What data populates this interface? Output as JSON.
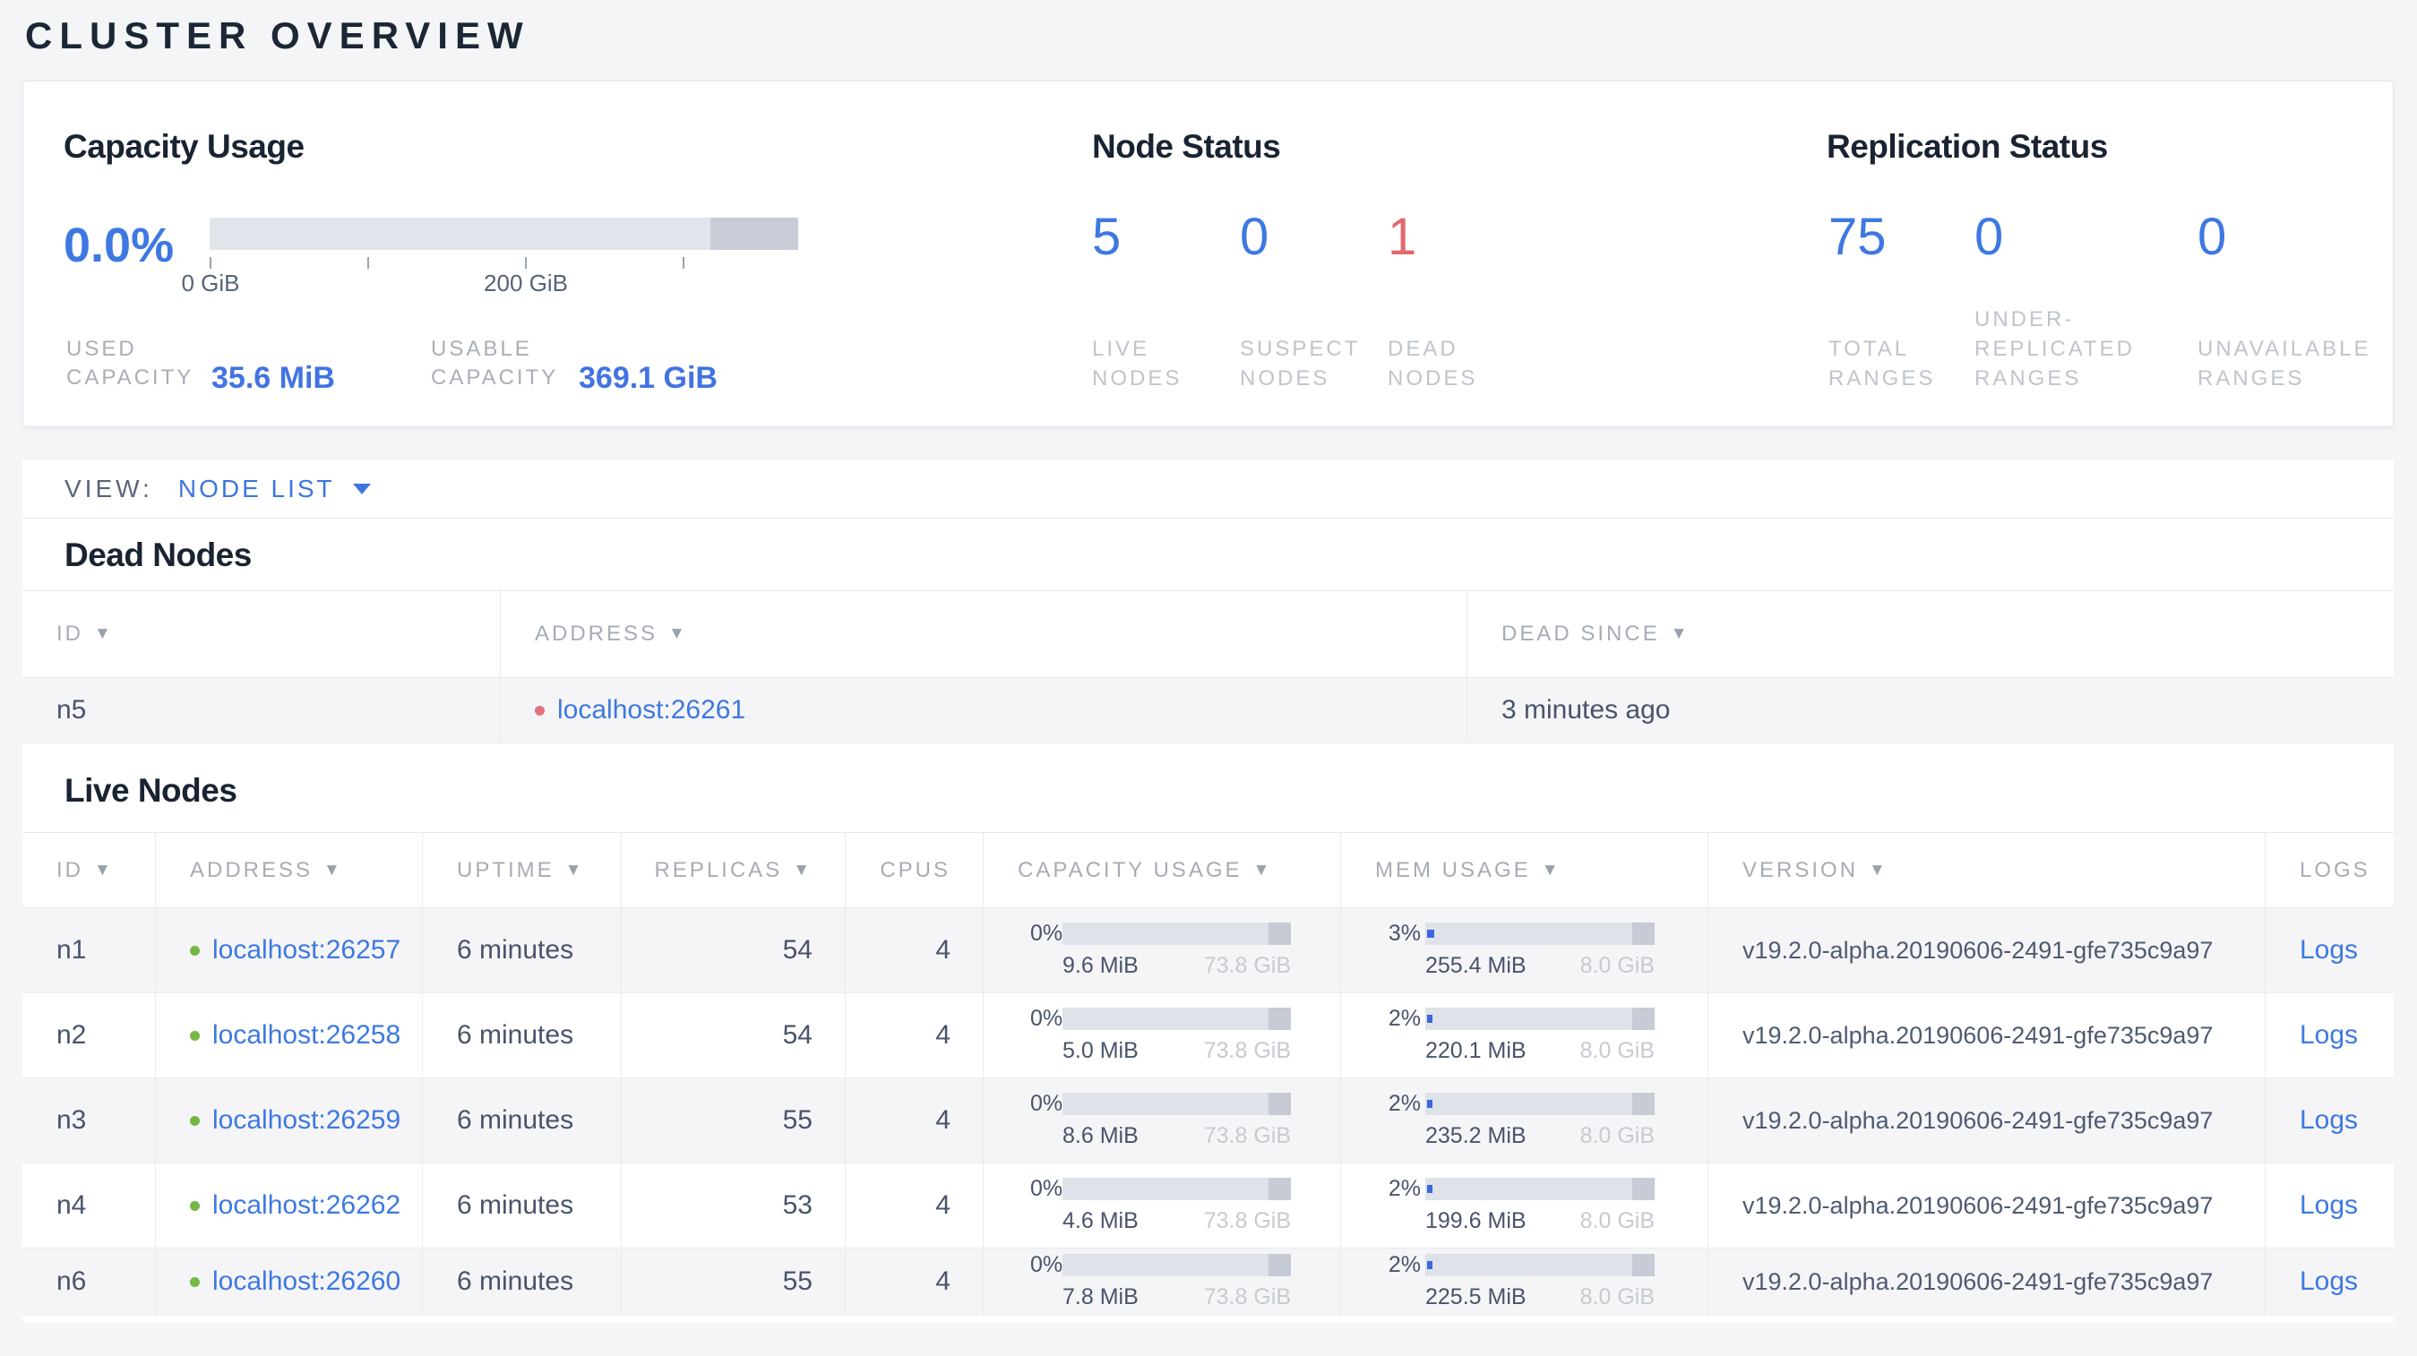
{
  "page_title": "CLUSTER OVERVIEW",
  "colors": {
    "accent_blue": "#3e78e1",
    "danger_red": "#e0696e",
    "live_green": "#76b847",
    "dead_dot": "#e0737c",
    "link_blue": "#3d79e0"
  },
  "summary": {
    "capacity": {
      "title": "Capacity Usage",
      "percent": "0.0%",
      "axis_ticks": [
        {
          "label": "0 GiB"
        },
        {
          "label": ""
        },
        {
          "label": "200 GiB"
        },
        {
          "label": ""
        }
      ],
      "stats": [
        {
          "label": "USED\nCAPACITY",
          "value": "35.6 MiB"
        },
        {
          "label": "USABLE\nCAPACITY",
          "value": "369.1 GiB"
        }
      ]
    },
    "node_status": {
      "title": "Node Status",
      "stats": [
        {
          "value": "5",
          "label": "LIVE\nNODES",
          "color": "blue"
        },
        {
          "value": "0",
          "label": "SUSPECT\nNODES",
          "color": "blue"
        },
        {
          "value": "1",
          "label": "DEAD\nNODES",
          "color": "red"
        }
      ]
    },
    "replication": {
      "title": "Replication Status",
      "stats": [
        {
          "value": "75",
          "label": "TOTAL\nRANGES",
          "color": "blue"
        },
        {
          "value": "0",
          "label": "UNDER-\nREPLICATED\nRANGES",
          "color": "blue"
        },
        {
          "value": "0",
          "label": "UNAVAILABLE\nRANGES",
          "color": "blue"
        }
      ]
    }
  },
  "view_bar": {
    "label": "VIEW:",
    "value": "NODE LIST"
  },
  "dead_nodes": {
    "title": "Dead Nodes",
    "columns": [
      {
        "label": "ID",
        "sortable": true
      },
      {
        "label": "ADDRESS",
        "sortable": true
      },
      {
        "label": "DEAD SINCE",
        "sortable": true
      }
    ],
    "rows": [
      {
        "id": "n5",
        "address": "localhost:26261",
        "dead_since": "3 minutes ago"
      }
    ]
  },
  "live_nodes": {
    "title": "Live Nodes",
    "columns": [
      {
        "label": "ID",
        "sortable": true
      },
      {
        "label": "ADDRESS",
        "sortable": true
      },
      {
        "label": "UPTIME",
        "sortable": true
      },
      {
        "label": "REPLICAS",
        "sortable": true,
        "align": "right"
      },
      {
        "label": "CPUS",
        "sortable": false,
        "align": "right"
      },
      {
        "label": "CAPACITY USAGE",
        "sortable": true
      },
      {
        "label": "MEM USAGE",
        "sortable": true
      },
      {
        "label": "VERSION",
        "sortable": true
      },
      {
        "label": "LOGS",
        "sortable": false
      }
    ],
    "rows": [
      {
        "id": "n1",
        "address": "localhost:26257",
        "uptime": "6 minutes",
        "replicas": "54",
        "cpus": "4",
        "capacity": {
          "percent": "0%",
          "pct_num": 0,
          "used": "9.6 MiB",
          "total": "73.8 GiB"
        },
        "memory": {
          "percent": "3%",
          "pct_num": 3,
          "used": "255.4 MiB",
          "total": "8.0 GiB"
        },
        "version": "v19.2.0-alpha.20190606-2491-gfe735c9a97",
        "logs_label": "Logs"
      },
      {
        "id": "n2",
        "address": "localhost:26258",
        "uptime": "6 minutes",
        "replicas": "54",
        "cpus": "4",
        "capacity": {
          "percent": "0%",
          "pct_num": 0,
          "used": "5.0 MiB",
          "total": "73.8 GiB"
        },
        "memory": {
          "percent": "2%",
          "pct_num": 2,
          "used": "220.1 MiB",
          "total": "8.0 GiB"
        },
        "version": "v19.2.0-alpha.20190606-2491-gfe735c9a97",
        "logs_label": "Logs"
      },
      {
        "id": "n3",
        "address": "localhost:26259",
        "uptime": "6 minutes",
        "replicas": "55",
        "cpus": "4",
        "capacity": {
          "percent": "0%",
          "pct_num": 0,
          "used": "8.6 MiB",
          "total": "73.8 GiB"
        },
        "memory": {
          "percent": "2%",
          "pct_num": 2,
          "used": "235.2 MiB",
          "total": "8.0 GiB"
        },
        "version": "v19.2.0-alpha.20190606-2491-gfe735c9a97",
        "logs_label": "Logs"
      },
      {
        "id": "n4",
        "address": "localhost:26262",
        "uptime": "6 minutes",
        "replicas": "53",
        "cpus": "4",
        "capacity": {
          "percent": "0%",
          "pct_num": 0,
          "used": "4.6 MiB",
          "total": "73.8 GiB"
        },
        "memory": {
          "percent": "2%",
          "pct_num": 2,
          "used": "199.6 MiB",
          "total": "8.0 GiB"
        },
        "version": "v19.2.0-alpha.20190606-2491-gfe735c9a97",
        "logs_label": "Logs"
      },
      {
        "id": "n6",
        "address": "localhost:26260",
        "uptime": "6 minutes",
        "replicas": "55",
        "cpus": "4",
        "capacity": {
          "percent": "0%",
          "pct_num": 0,
          "used": "7.8 MiB",
          "total": "73.8 GiB"
        },
        "memory": {
          "percent": "2%",
          "pct_num": 2,
          "used": "225.5 MiB",
          "total": "8.0 GiB"
        },
        "version": "v19.2.0-alpha.20190606-2491-gfe735c9a97",
        "logs_label": "Logs"
      }
    ]
  }
}
